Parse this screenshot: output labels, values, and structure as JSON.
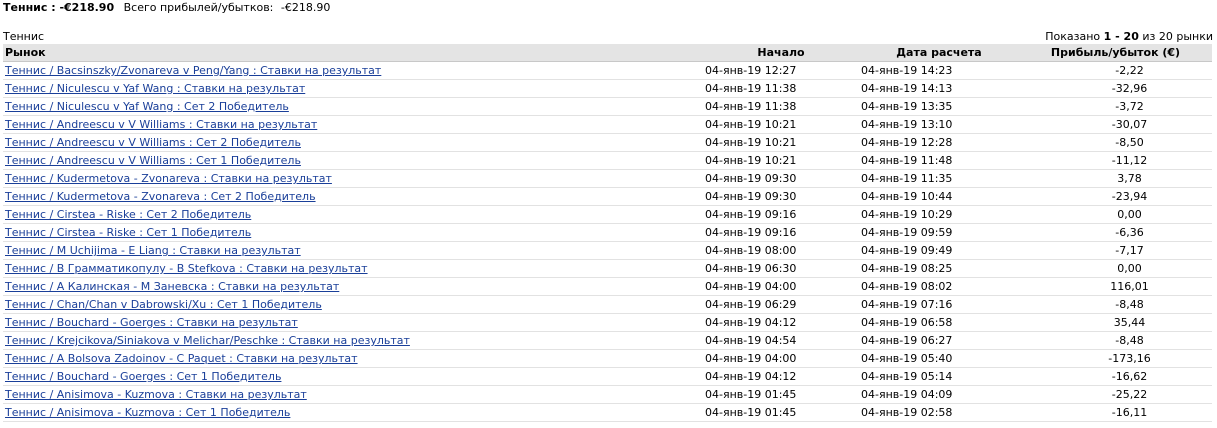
{
  "summary": {
    "sport_total": "Теннис : -€218.90",
    "all_label": "Всего прибылей/убытков:",
    "all_value": "-€218.90"
  },
  "section": {
    "title": "Теннис",
    "pager_prefix": "Показано",
    "pager_range": "1 - 20",
    "pager_suffix": "из 20 рынки"
  },
  "table": {
    "headers": {
      "market": "Рынок",
      "start": "Начало",
      "settled": "Дата расчета",
      "pl": "Прибыль/убыток (€)"
    },
    "rows": [
      {
        "market": "Теннис / Bacsinszky/Zvonareva v Peng/Yang : Ставки на результат",
        "start": "04-янв-19 12:27",
        "settled": "04-янв-19 14:23",
        "pl": "-2,22"
      },
      {
        "market": "Теннис / Niculescu v Yaf Wang : Ставки на результат",
        "start": "04-янв-19 11:38",
        "settled": "04-янв-19 14:13",
        "pl": "-32,96"
      },
      {
        "market": "Теннис / Niculescu v Yaf Wang : Сет 2 Победитель",
        "start": "04-янв-19 11:38",
        "settled": "04-янв-19 13:35",
        "pl": "-3,72"
      },
      {
        "market": "Теннис / Andreescu v V Williams : Ставки на результат",
        "start": "04-янв-19 10:21",
        "settled": "04-янв-19 13:10",
        "pl": "-30,07"
      },
      {
        "market": "Теннис / Andreescu v V Williams : Сет 2 Победитель",
        "start": "04-янв-19 10:21",
        "settled": "04-янв-19 12:28",
        "pl": "-8,50"
      },
      {
        "market": "Теннис / Andreescu v V Williams : Сет 1 Победитель",
        "start": "04-янв-19 10:21",
        "settled": "04-янв-19 11:48",
        "pl": "-11,12"
      },
      {
        "market": "Теннис / Kudermetova - Zvonareva : Ставки на результат",
        "start": "04-янв-19 09:30",
        "settled": "04-янв-19 11:35",
        "pl": "3,78"
      },
      {
        "market": "Теннис / Kudermetova - Zvonareva : Сет 2 Победитель",
        "start": "04-янв-19 09:30",
        "settled": "04-янв-19 10:44",
        "pl": "-23,94"
      },
      {
        "market": "Теннис / Cirstea - Riske : Сет 2 Победитель",
        "start": "04-янв-19 09:16",
        "settled": "04-янв-19 10:29",
        "pl": "0,00"
      },
      {
        "market": "Теннис / Cirstea - Riske : Сет 1 Победитель",
        "start": "04-янв-19 09:16",
        "settled": "04-янв-19 09:59",
        "pl": "-6,36"
      },
      {
        "market": "Теннис / M Uchijima - E Liang : Ставки на результат",
        "start": "04-янв-19 08:00",
        "settled": "04-янв-19 09:49",
        "pl": "-7,17"
      },
      {
        "market": "Теннис / В Грамматикопулу - B Stefkova : Ставки на результат",
        "start": "04-янв-19 06:30",
        "settled": "04-янв-19 08:25",
        "pl": "0,00"
      },
      {
        "market": "Теннис / А Калинская - М Заневска : Ставки на результат",
        "start": "04-янв-19 04:00",
        "settled": "04-янв-19 08:02",
        "pl": "116,01"
      },
      {
        "market": "Теннис / Chan/Chan v Dabrowski/Xu : Сет 1 Победитель",
        "start": "04-янв-19 06:29",
        "settled": "04-янв-19 07:16",
        "pl": "-8,48"
      },
      {
        "market": "Теннис / Bouchard - Goerges : Ставки на результат",
        "start": "04-янв-19 04:12",
        "settled": "04-янв-19 06:58",
        "pl": "35,44"
      },
      {
        "market": "Теннис / Krejcikova/Siniakova v Melichar/Peschke : Ставки на результат",
        "start": "04-янв-19 04:54",
        "settled": "04-янв-19 06:27",
        "pl": "-8,48"
      },
      {
        "market": "Теннис / A Bolsova Zadoinov - C Paquet : Ставки на результат",
        "start": "04-янв-19 04:00",
        "settled": "04-янв-19 05:40",
        "pl": "-173,16"
      },
      {
        "market": "Теннис / Bouchard - Goerges : Сет 1 Победитель",
        "start": "04-янв-19 04:12",
        "settled": "04-янв-19 05:14",
        "pl": "-16,62"
      },
      {
        "market": "Теннис / Anisimova - Kuzmova : Ставки на результат",
        "start": "04-янв-19 01:45",
        "settled": "04-янв-19 04:09",
        "pl": "-25,22"
      },
      {
        "market": "Теннис / Anisimova - Kuzmova : Сет 1 Победитель",
        "start": "04-янв-19 01:45",
        "settled": "04-янв-19 02:58",
        "pl": "-16,11"
      }
    ]
  },
  "colors": {
    "link": "#1a3f99",
    "header_bg": "#e4e4e4"
  }
}
